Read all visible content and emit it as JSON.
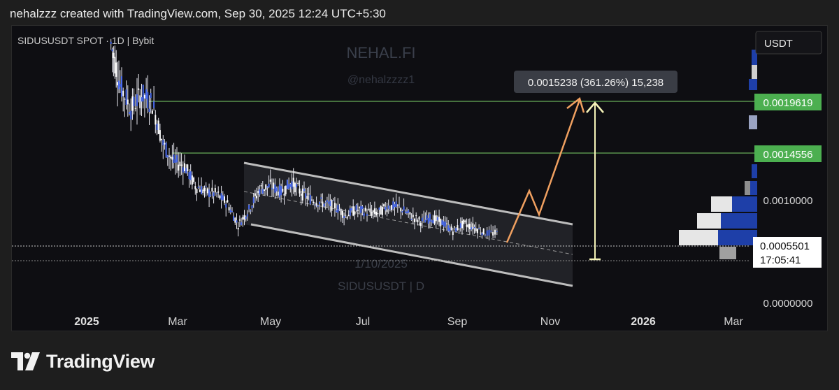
{
  "header": {
    "attribution": "nehalzzz created with TradingView.com, Sep 30, 2025 12:24 UTC+5:30"
  },
  "chart": {
    "symbol_label": "SIDUSUSDT SPOT · 1D | Bybit",
    "watermark_title": "NEHAL.FI",
    "watermark_handle": "@nehalzzzz1",
    "watermark_date": "1/10/2025",
    "watermark_symbol": "SIDUSUSDT | D",
    "currency_label": "USDT",
    "measure_label": "0.0015238 (361.26%) 15,238",
    "last_price_label": "0.0005501",
    "countdown_label": "17:05:41",
    "colors": {
      "candle": "#4a6cf0",
      "channel": "#bdbdbd",
      "target_line": "#7fd46a",
      "target_badge": "#4caf50",
      "arrow_orange": "#f0a060",
      "measure_arrow": "#f5f3b8",
      "volume_gray": "#e0e0e0",
      "volume_blue": "#1e3fa8"
    }
  },
  "chart_data": {
    "type": "candlestick",
    "title": "SIDUSUSDT SPOT · 1D | Bybit",
    "x_ticks": [
      "2025",
      "Mar",
      "May",
      "Jul",
      "Sep",
      "Nov",
      "2026",
      "Mar"
    ],
    "y_ticks": [
      "0.0010000",
      "0.0000000"
    ],
    "price_levels": [
      {
        "label": "0.0019619",
        "value": 0.0019619,
        "style": "resistance"
      },
      {
        "label": "0.0014556",
        "value": 0.0014556,
        "style": "resistance"
      },
      {
        "label": "0.0005501",
        "value": 0.0005501,
        "style": "last"
      }
    ],
    "ylim": [
      0.0,
      0.0023
    ],
    "series_approx_close": [
      [
        "2025-01-20",
        0.00215
      ],
      [
        "2025-01-26",
        0.0018
      ],
      [
        "2025-02-02",
        0.0016
      ],
      [
        "2025-02-09",
        0.00172
      ],
      [
        "2025-02-16",
        0.00165
      ],
      [
        "2025-02-23",
        0.0013
      ],
      [
        "2025-03-02",
        0.00115
      ],
      [
        "2025-03-09",
        0.00112
      ],
      [
        "2025-03-16",
        0.00095
      ],
      [
        "2025-03-23",
        0.0009
      ],
      [
        "2025-03-30",
        0.00088
      ],
      [
        "2025-04-06",
        0.0008
      ],
      [
        "2025-04-13",
        0.00062
      ],
      [
        "2025-04-20",
        0.00075
      ],
      [
        "2025-04-27",
        0.00092
      ],
      [
        "2025-05-04",
        0.00095
      ],
      [
        "2025-05-11",
        0.0009
      ],
      [
        "2025-05-18",
        0.00098
      ],
      [
        "2025-05-25",
        0.00088
      ],
      [
        "2025-06-01",
        0.00083
      ],
      [
        "2025-06-08",
        0.0008
      ],
      [
        "2025-06-15",
        0.00078
      ],
      [
        "2025-06-22",
        0.0007
      ],
      [
        "2025-06-29",
        0.00075
      ],
      [
        "2025-07-06",
        0.00073
      ],
      [
        "2025-07-13",
        0.00072
      ],
      [
        "2025-07-20",
        0.00078
      ],
      [
        "2025-07-27",
        0.00077
      ],
      [
        "2025-08-03",
        0.0007
      ],
      [
        "2025-08-10",
        0.00065
      ],
      [
        "2025-08-17",
        0.00068
      ],
      [
        "2025-08-24",
        0.00064
      ],
      [
        "2025-08-31",
        0.00057
      ],
      [
        "2025-09-07",
        0.00063
      ],
      [
        "2025-09-14",
        0.0006
      ],
      [
        "2025-09-21",
        0.00055
      ],
      [
        "2025-09-30",
        0.00055
      ]
    ],
    "measure": {
      "value": 0.0015238,
      "percent": 361.26,
      "ticks": 15238
    }
  },
  "footer": {
    "brand": "TradingView"
  }
}
